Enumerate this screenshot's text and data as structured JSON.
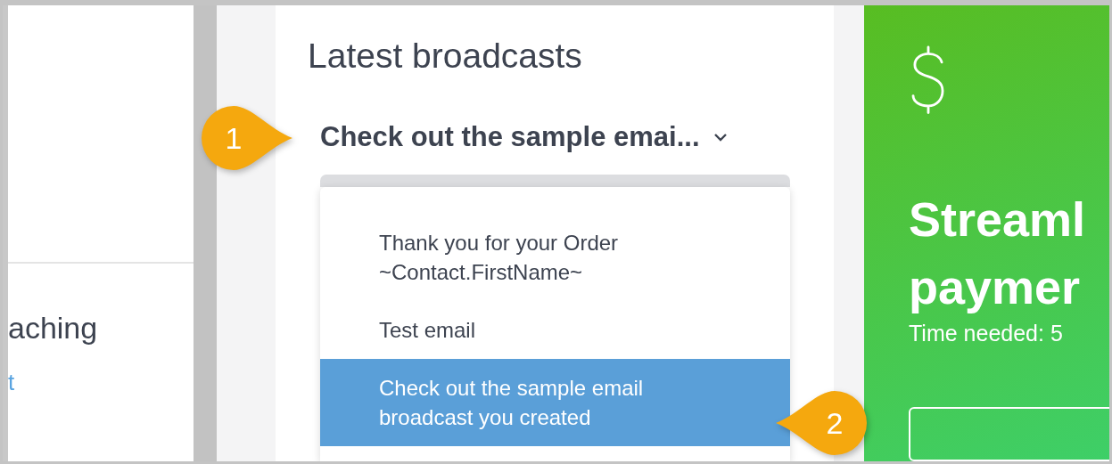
{
  "left_panel": {
    "heading": "aching",
    "link": "t"
  },
  "broadcasts": {
    "title": "Latest broadcasts",
    "dropdown": {
      "value": "Check out the sample emai...",
      "expanded": true
    },
    "options": [
      {
        "label": "Thank you for your Order ~Contact.FirstName~",
        "selected": false
      },
      {
        "label": "Test email",
        "selected": false
      },
      {
        "label": "Check out the sample email broadcast you created",
        "selected": true
      }
    ]
  },
  "promo": {
    "heading": "Streaml paymer",
    "time_needed": "Time needed: 5"
  },
  "callouts": [
    {
      "number": "1",
      "kind": "right"
    },
    {
      "number": "2",
      "kind": "left"
    }
  ]
}
